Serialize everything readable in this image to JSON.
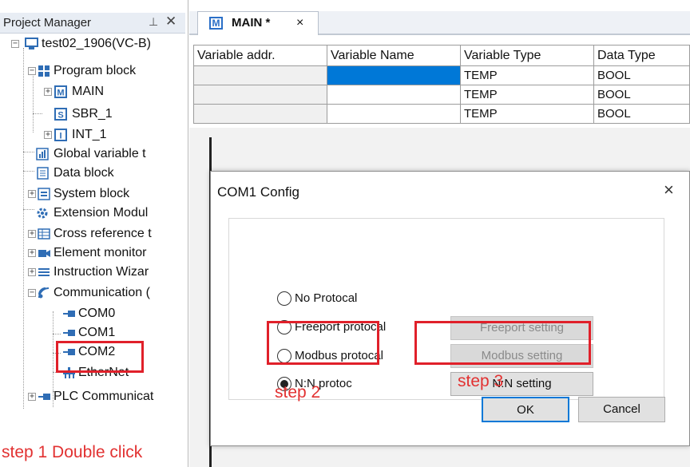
{
  "project_manager": {
    "title": "Project Manager",
    "pin_icon": "pin-icon",
    "close_glyph": "✕"
  },
  "tree": {
    "root": {
      "label": "test02_1906(VC-B)",
      "icon": "computer-icon"
    },
    "program_block": {
      "label": "Program block",
      "icon": "program-block-icon"
    },
    "main": {
      "label": "MAIN",
      "icon": "main-program-icon"
    },
    "sbr1": {
      "label": "SBR_1",
      "icon": "subroutine-icon"
    },
    "int1": {
      "label": "INT_1",
      "icon": "interrupt-icon"
    },
    "global_var": {
      "label": "Global variable t",
      "icon": "chart-icon"
    },
    "data_block": {
      "label": "Data block",
      "icon": "document-icon"
    },
    "system_block": {
      "label": "System block",
      "icon": "system-block-icon"
    },
    "extension": {
      "label": "Extension Modul",
      "icon": "gear-icon"
    },
    "cross_ref": {
      "label": "Cross reference t",
      "icon": "table-icon"
    },
    "element_monitor": {
      "label": "Element monitor",
      "icon": "camera-icon"
    },
    "instruction_wizard": {
      "label": "Instruction Wizar",
      "icon": "list-icon"
    },
    "communication": {
      "label": "Communication (",
      "icon": "satellite-icon"
    },
    "com0": {
      "label": "COM0",
      "icon": "serial-port-icon"
    },
    "com1": {
      "label": "COM1",
      "icon": "serial-port-icon"
    },
    "com2": {
      "label": "COM2",
      "icon": "serial-port-icon"
    },
    "ethernet": {
      "label": "EtherNet",
      "icon": "ethernet-icon"
    },
    "plc_comm": {
      "label": "PLC Communicat",
      "icon": "serial-port-icon"
    }
  },
  "editor": {
    "tab_label": "MAIN *",
    "tab_icon_letter": "M",
    "tab_close": "×",
    "columns": [
      "Variable addr.",
      "Variable Name",
      "Variable Type",
      "Data Type"
    ],
    "rows": [
      {
        "addr": "",
        "name": "",
        "type": "TEMP",
        "dtype": "BOOL"
      },
      {
        "addr": "",
        "name": "",
        "type": "TEMP",
        "dtype": "BOOL"
      },
      {
        "addr": "",
        "name": "",
        "type": "TEMP",
        "dtype": "BOOL"
      }
    ]
  },
  "dialog": {
    "title": "COM1 Config",
    "close_glyph": "×",
    "options": [
      {
        "label": "No Protocal",
        "selected": false
      },
      {
        "label": "Freeport protocal",
        "selected": false
      },
      {
        "label": "Modbus protocal",
        "selected": false
      },
      {
        "label": "N:N protoc",
        "selected": true
      }
    ],
    "freeport_setting": "Freeport setting",
    "modbus_setting": "Modbus setting",
    "nn_setting": "N:N setting",
    "ok": "OK",
    "cancel": "Cancel"
  },
  "annotations": {
    "step1": "step 1 Double click",
    "step2": "step 2",
    "step3": "step 3",
    "color": "#e0202a"
  }
}
